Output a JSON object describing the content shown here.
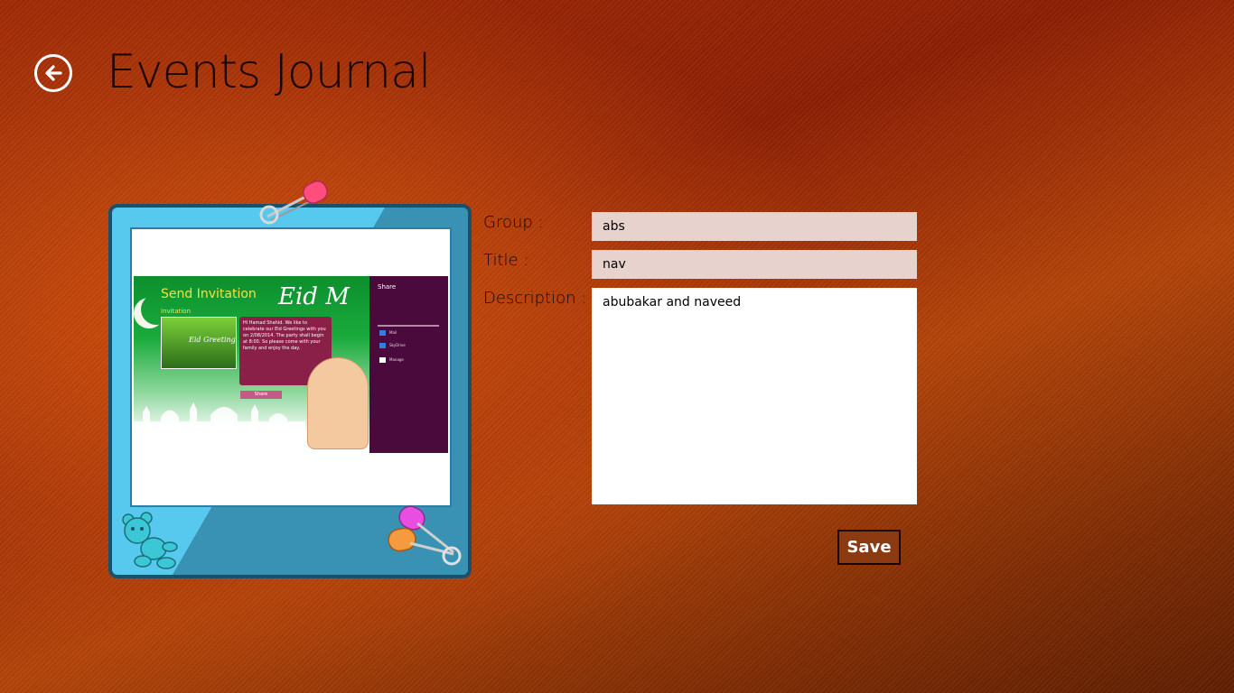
{
  "header": {
    "back_icon": "back-arrow-icon",
    "title": "Events Journal"
  },
  "photo": {
    "screenshot_title": "Send Invitation",
    "screenshot_subtitle": "Invitation",
    "screenshot_eid": "Eid M",
    "screenshot_card": "Eid Greeting",
    "screenshot_message": "Hi Hamad Shahid. We like to celebrate our Eid Greetings with you on 2/08/2014. The party shall begin at 8:00. So please come with your family and enjoy the day.",
    "screenshot_share_button": "Share",
    "share_panel_title": "Share",
    "share_items": [
      "Mail",
      "SkyDrive",
      "Manage"
    ]
  },
  "form": {
    "group_label": "Group :",
    "group_value": "abs",
    "title_label": "Title :",
    "title_value": "nav",
    "description_label": "Description :",
    "description_value": "abubakar and naveed"
  },
  "actions": {
    "save_label": "Save"
  },
  "colors": {
    "frame": "#57c9ee",
    "frame_border": "#1b4f6a",
    "input_bg": "#e8d2cd",
    "save_bg": "#8b3a12"
  }
}
